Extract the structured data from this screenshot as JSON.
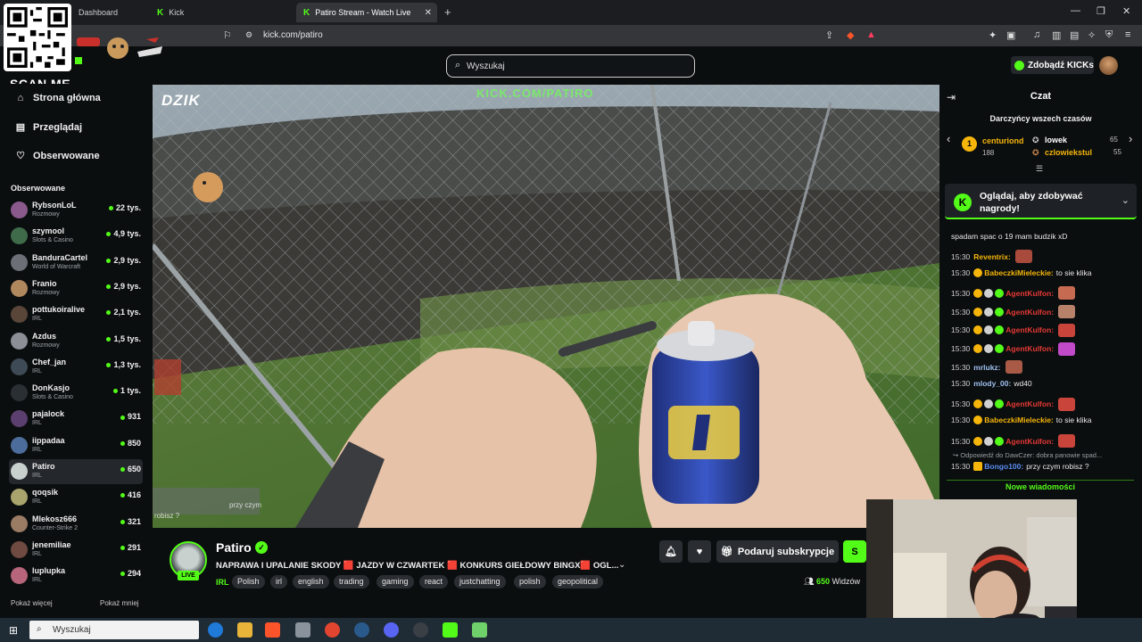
{
  "browser": {
    "tabs": [
      {
        "label": "Dashboard",
        "active": false
      },
      {
        "label": "Kick",
        "active": false
      },
      {
        "label": "Patiro Stream - Watch Live on",
        "active": true
      }
    ],
    "url": "kick.com/patiro"
  },
  "overlay": {
    "scan_me": "SCAN ME"
  },
  "header": {
    "search_placeholder": "Wyszukaj",
    "get_kicks": "Zdobądź KICKs"
  },
  "sidebar": {
    "nav": [
      {
        "label": "Strona główna",
        "icon": "home-icon"
      },
      {
        "label": "Przeglądaj",
        "icon": "browse-icon"
      },
      {
        "label": "Obserwowane",
        "icon": "heart-icon"
      }
    ],
    "followed_title": "Obserwowane",
    "channels": [
      {
        "name": "RybsonLoL",
        "category": "Rozmowy",
        "viewers": "22 tys.",
        "live": true,
        "color": "#8a5a8c"
      },
      {
        "name": "szymool",
        "category": "Slots & Casino",
        "viewers": "4,9 tys.",
        "live": true,
        "color": "#3f6b4a"
      },
      {
        "name": "BanduraCartel",
        "category": "World of Warcraft",
        "viewers": "2,9 tys.",
        "live": true,
        "color": "#6c6f76"
      },
      {
        "name": "Franio",
        "category": "Rozmowy",
        "viewers": "2,9 tys.",
        "live": true,
        "color": "#b0885e"
      },
      {
        "name": "pottukoiralive",
        "category": "IRL",
        "viewers": "2,1 tys.",
        "live": true,
        "color": "#5a4638"
      },
      {
        "name": "Azdus",
        "category": "Rozmowy",
        "viewers": "1,5 tys.",
        "live": true,
        "color": "#8c8f96"
      },
      {
        "name": "Chef_jan",
        "category": "IRL",
        "viewers": "1,3 tys.",
        "live": true,
        "color": "#3e4a55"
      },
      {
        "name": "DonKasjo",
        "category": "Slots & Casino",
        "viewers": "1 tys.",
        "live": true,
        "color": "#2a2f34"
      },
      {
        "name": "pajalock",
        "category": "IRL",
        "viewers": "931",
        "live": true,
        "color": "#5b3f6e"
      },
      {
        "name": "iippadaa",
        "category": "IRL",
        "viewers": "850",
        "live": true,
        "color": "#4c6d9c"
      },
      {
        "name": "Patiro",
        "category": "IRL",
        "viewers": "650",
        "live": true,
        "color": "#c9d1cf"
      },
      {
        "name": "qoqsik",
        "category": "IRL",
        "viewers": "416",
        "live": true,
        "color": "#a9a36d"
      },
      {
        "name": "Mlekosz666",
        "category": "Counter-Strike 2",
        "viewers": "321",
        "live": true,
        "color": "#9a7b64"
      },
      {
        "name": "jenemiliae",
        "category": "IRL",
        "viewers": "291",
        "live": true,
        "color": "#6e4a40"
      },
      {
        "name": "luplupka",
        "category": "IRL",
        "viewers": "294",
        "live": true,
        "color": "#b7657a"
      }
    ],
    "show_more": "Pokaż więcej",
    "show_less": "Pokaż mniej"
  },
  "video": {
    "overlay_logo": "DZIK",
    "overlay_url": "KICK.COM/PATIRO",
    "overlay_chat_1": "przy czym",
    "overlay_chat_2": "robisz ?"
  },
  "stream": {
    "channel_name": "Patiro",
    "live_badge": "LIVE",
    "title": "NAPRAWA I UPALANIE SKODY 🟥 JAZDY W CZWARTEK 🟥 KONKURS GIEŁDOWY BINGX🟥 OGL...",
    "category": "IRL",
    "tags": [
      "Polish",
      "irl",
      "english",
      "trading",
      "gaming",
      "react",
      "justchatting",
      "polish",
      "geopolitical"
    ],
    "gift_sub_label": "Podaruj subskrypcje",
    "subscribe_label": "S",
    "viewer_count": "650",
    "viewer_suffix": "Widzów"
  },
  "chat": {
    "title": "Czat",
    "top_donors_title": "Darczyńcy wszech czasów",
    "donors": [
      {
        "rank": "1",
        "name": "centuriond",
        "amount": "188"
      },
      {
        "name": "lowek",
        "amount": "65"
      },
      {
        "name": "czlowiekstul",
        "amount": "55"
      }
    ],
    "rewards_text": "Oglądaj, aby zdobywać nagrody!",
    "partial_message": "spadam spac o 19 mam budzik xD",
    "messages": [
      {
        "time": "15:30",
        "user": "Reventrix:",
        "text": "",
        "user_color": "#f5b50a",
        "badges": [],
        "emote": "#a84a3c"
      },
      {
        "time": "15:30",
        "user": "BabeczkiMieleckie:",
        "text": "to sie klika",
        "user_color": "#f5b50a",
        "badges": [
          "#f5b50a"
        ],
        "emote": ""
      },
      {
        "time": "15:30",
        "user": "AgentKulfon:",
        "text": "",
        "user_color": "#e53935",
        "badges": [
          "#f5b50a",
          "#d0d0d0",
          "#53fc18"
        ],
        "emote": "#c76a52"
      },
      {
        "time": "15:30",
        "user": "AgentKulfon:",
        "text": "",
        "user_color": "#e53935",
        "badges": [
          "#f5b50a",
          "#d0d0d0",
          "#53fc18"
        ],
        "emote": "#b8826a"
      },
      {
        "time": "15:30",
        "user": "AgentKulfon:",
        "text": "",
        "user_color": "#e53935",
        "badges": [
          "#f5b50a",
          "#d0d0d0",
          "#53fc18"
        ],
        "emote": "#c9443a"
      },
      {
        "time": "15:30",
        "user": "AgentKulfon:",
        "text": "",
        "user_color": "#e53935",
        "badges": [
          "#f5b50a",
          "#d0d0d0",
          "#53fc18"
        ],
        "emote": "#c04ac8"
      },
      {
        "time": "15:30",
        "user": "mrlukz:",
        "text": "",
        "user_color": "#9ec0f0",
        "badges": [],
        "emote": "#a85a46"
      },
      {
        "time": "15:30",
        "user": "mlody_00:",
        "text": "wd40",
        "user_color": "#9ec0f0",
        "badges": [],
        "emote": ""
      },
      {
        "time": "15:30",
        "user": "AgentKulfon:",
        "text": "",
        "user_color": "#e53935",
        "badges": [
          "#f5b50a",
          "#d0d0d0",
          "#53fc18"
        ],
        "emote": "#c9443a"
      },
      {
        "time": "15:30",
        "user": "BabeczkiMieleckie:",
        "text": "to sie klika",
        "user_color": "#f5b50a",
        "badges": [
          "#f5b50a"
        ],
        "emote": ""
      },
      {
        "time": "15:30",
        "user": "AgentKulfon:",
        "text": "",
        "user_color": "#e53935",
        "badges": [
          "#f5b50a",
          "#d0d0d0",
          "#53fc18"
        ],
        "emote": "#c9443a"
      }
    ],
    "reply_hint": "Odpowiedź do DawCzer: dobra panowie spad...",
    "last_message": {
      "time": "15:30",
      "user": "Bongo100:",
      "text": "przy czym robisz ?",
      "user_color": "#5a8cf0"
    },
    "new_messages": "Nowe wiadomości"
  },
  "taskbar": {
    "search_placeholder": "Wyszukaj"
  },
  "colors": {
    "accent": "#53fc18",
    "background": "#0b0e0f",
    "panel": "#24272c"
  }
}
